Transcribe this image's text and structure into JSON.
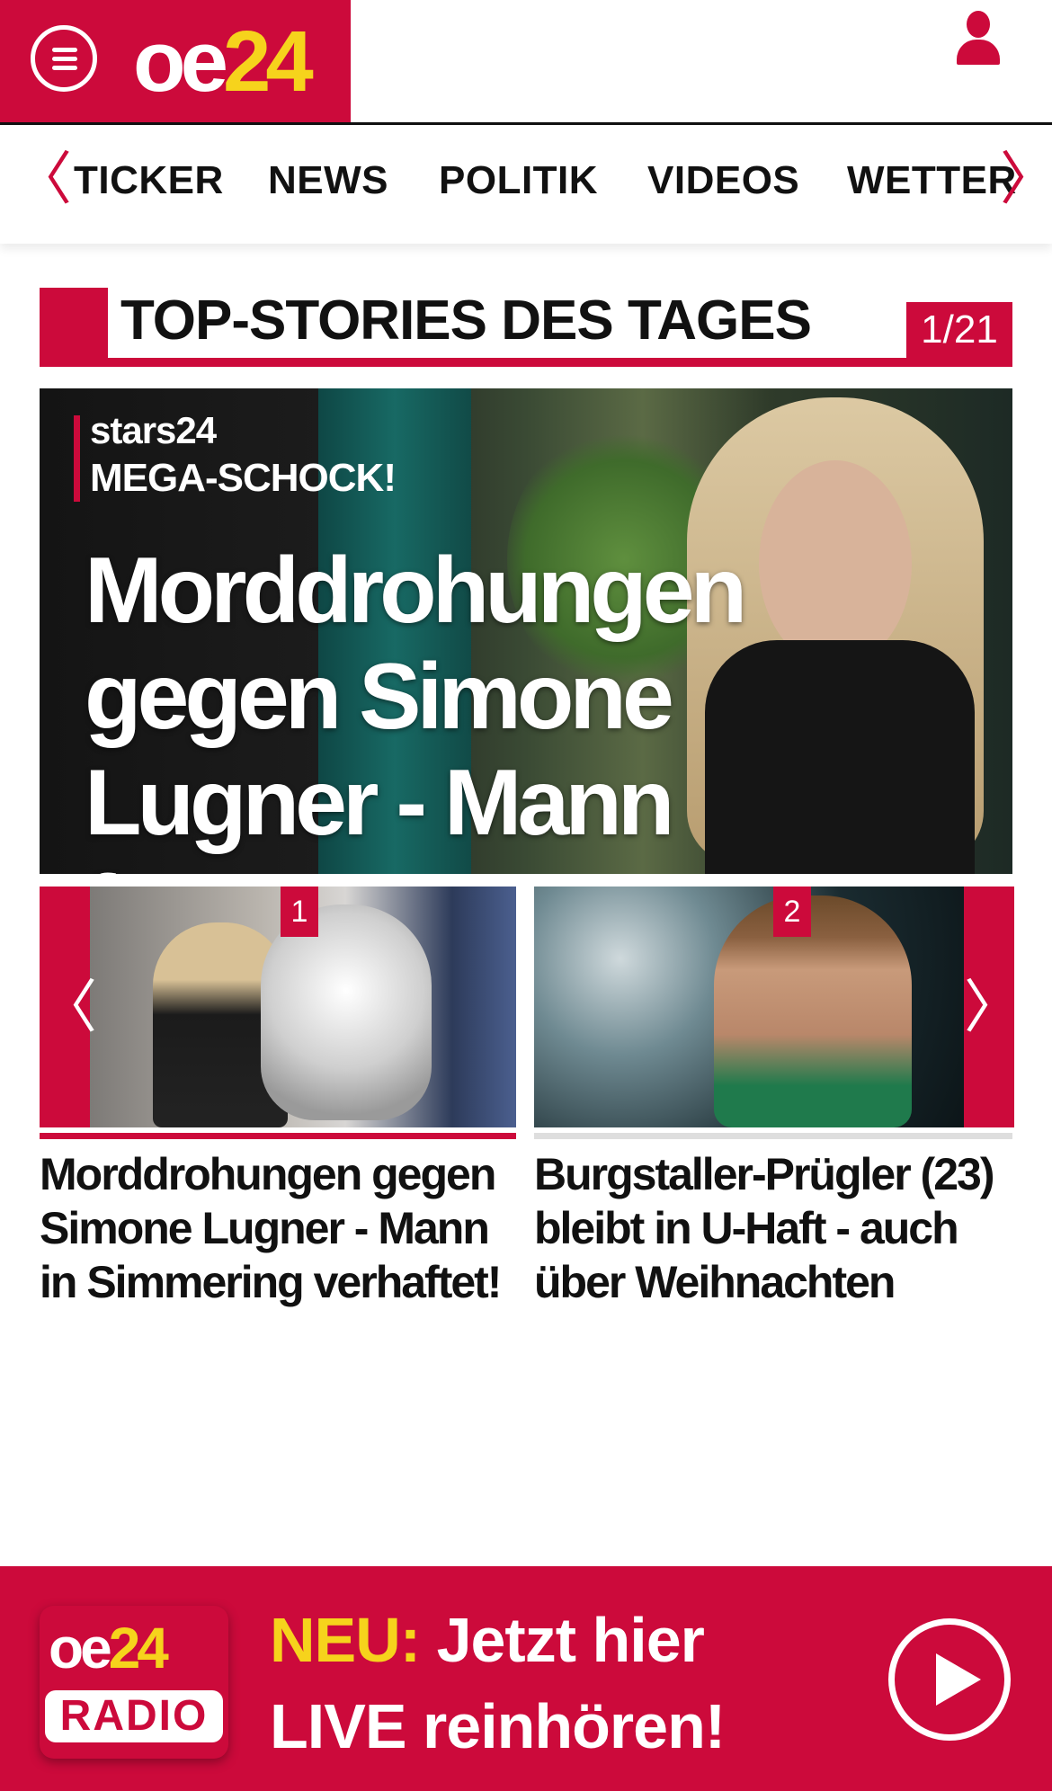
{
  "header": {
    "logo_oe": "oe",
    "logo_24": "24"
  },
  "nav": {
    "items": [
      "TICKER",
      "NEWS",
      "POLITIK",
      "VIDEOS",
      "WETTER"
    ],
    "prev_arrow": "〈",
    "next_arrow": "〉"
  },
  "section": {
    "title": "TOP-STORIES DES TAGES",
    "counter": "1/21"
  },
  "hero": {
    "brand": "stars24",
    "kicker": "MEGA-SCHOCK!",
    "title": "Morddrohungen gegen Simone Lugner - Mann festgenommen"
  },
  "carousel": {
    "prev_arrow": "〈",
    "next_arrow": "〉",
    "cards": [
      {
        "number": "1",
        "title": "Morddrohungen gegen Simone Lugner - Mann in Simmering verhaftet!"
      },
      {
        "number": "2",
        "title": "Burgstaller-Prügler (23) bleibt in U-Haft - auch über Weihnachten"
      }
    ]
  },
  "radio": {
    "logo_oe": "oe",
    "logo_24": "24",
    "logo_radio": "RADIO",
    "neu": "NEU:",
    "line1": "Jetzt hier",
    "line2": "LIVE reinhören!"
  },
  "colors": {
    "brand_red": "#cc0a3b",
    "brand_yellow": "#f6d31c"
  }
}
